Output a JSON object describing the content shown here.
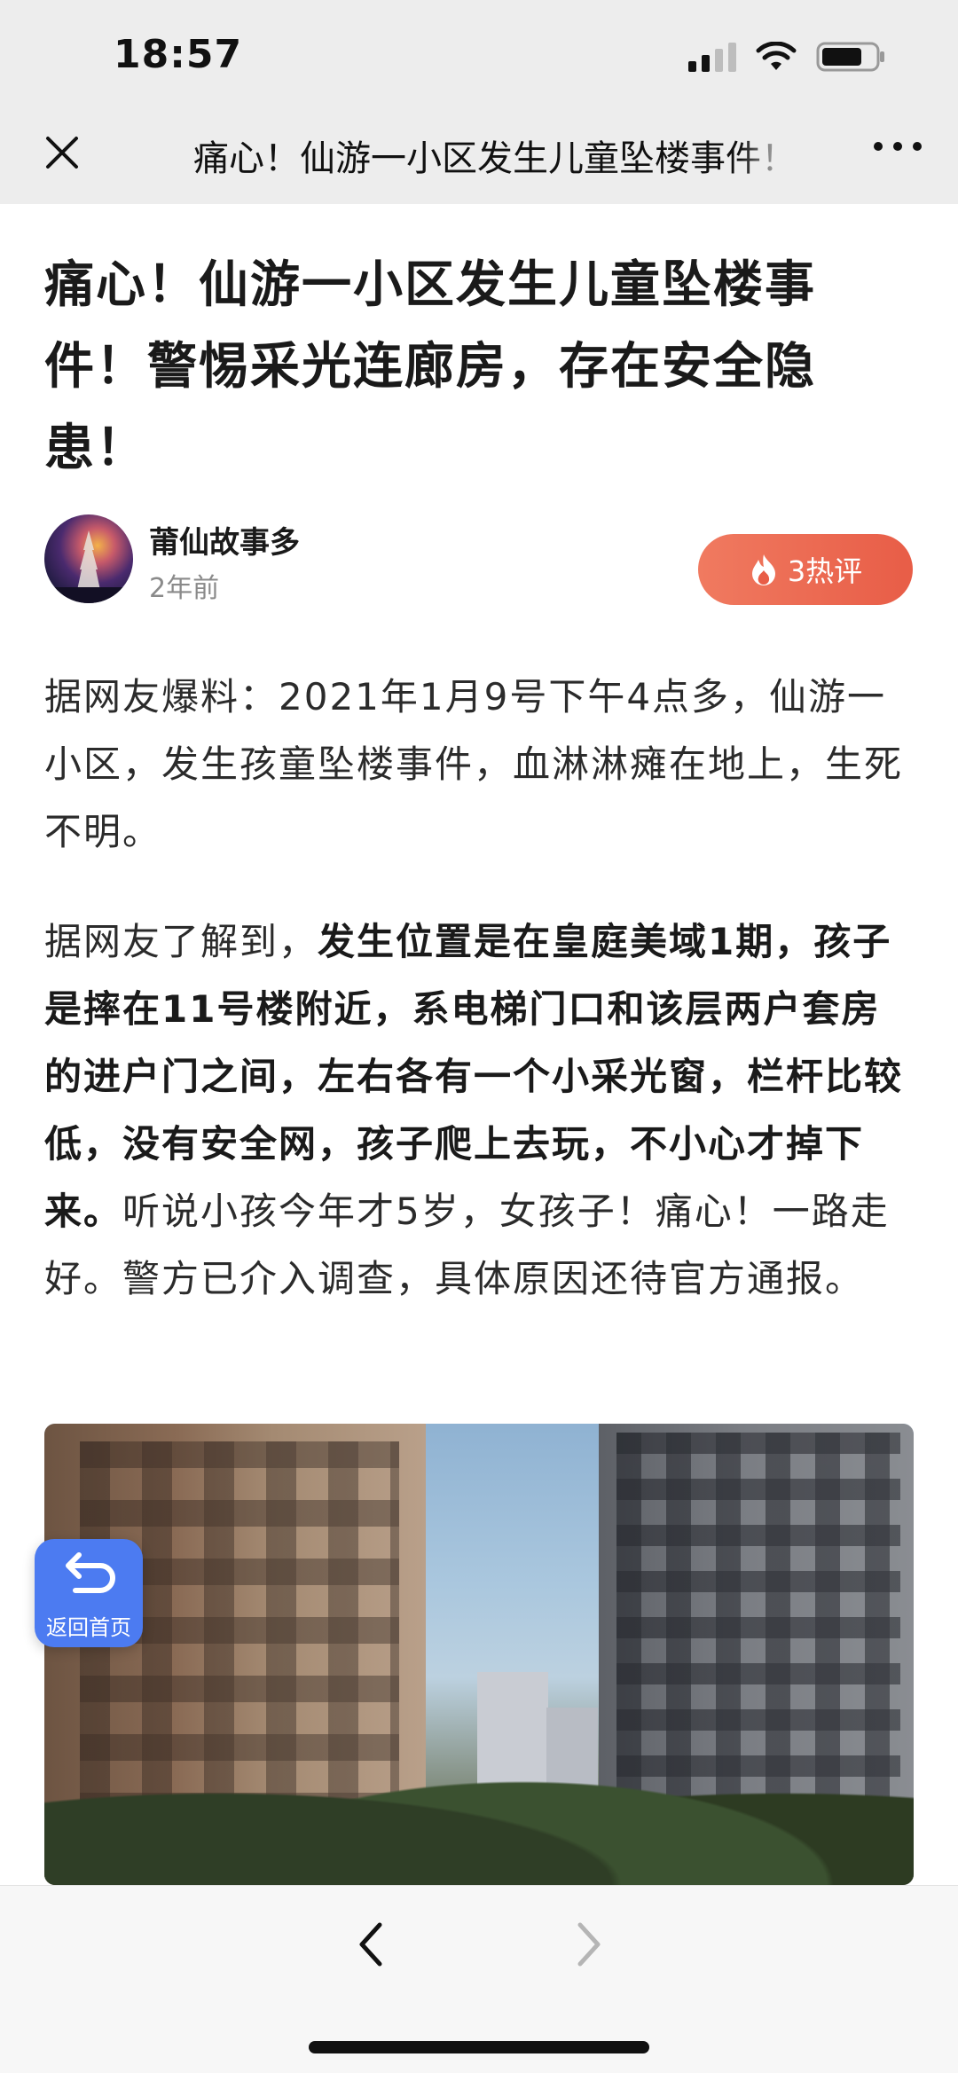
{
  "status_bar": {
    "time": "18:57"
  },
  "nav": {
    "title": "痛心！仙游一小区发生儿童坠楼事件！警惕采光连廊房，存在安全隐患！"
  },
  "article": {
    "title": "痛心！仙游一小区发生儿童坠楼事件！警惕采光连廊房，存在安全隐患！",
    "author": "莆仙故事多",
    "published": "2年前",
    "hot_comments": "3热评",
    "paragraph1": "据网友爆料：2021年1月9号下午4点多，仙游一小区，发生孩童坠楼事件，血淋淋瘫在地上，生死不明。",
    "paragraph2": {
      "lead": "据网友了解到，",
      "bold": "发生位置是在皇庭美域1期，孩子是摔在11号楼附近，系电梯门口和该层两户套房的进户门之间，左右各有一个小采光窗，栏杆比较低，没有安全网，孩子爬上去玩，不小心才掉下来。",
      "tail": "听说小孩今年才5岁，女孩子！痛心！一路走好。警方已介入调查，具体原因还待官方通报。"
    }
  },
  "floating": {
    "back_home": "返回首页"
  },
  "icons": {
    "close": "close-icon",
    "more": "more-icon",
    "fire": "fire-icon",
    "back": "chevron-left-icon",
    "forward": "chevron-right-icon",
    "return": "return-arrow-icon"
  },
  "colors": {
    "hot_button": "#e85d47",
    "back_home_button": "#4c7bf1"
  }
}
